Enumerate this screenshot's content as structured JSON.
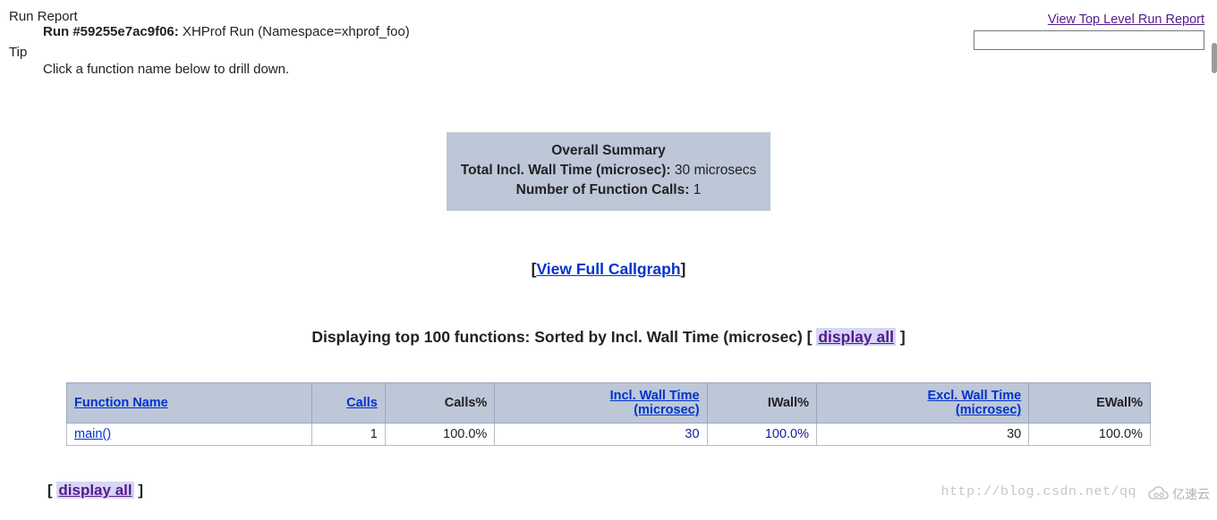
{
  "header": {
    "run_report": "Run Report",
    "run_line_bold": "Run #59255e7ac9f06:",
    "run_line_rest": " XHProf Run (Namespace=xhprof_foo)",
    "tip": "Tip",
    "tip_body": "Click a function name below to drill down."
  },
  "top_right": {
    "link": "View Top Level Run Report",
    "input_value": ""
  },
  "summary": {
    "title": "Overall Summary",
    "row1_label": "Total Incl. Wall Time (microsec):",
    "row1_value": " 30 microsecs",
    "row2_label": "Number of Function Calls:",
    "row2_value": " 1"
  },
  "callgraph": {
    "bracket_open": "[",
    "link": "View Full Callgraph",
    "bracket_close": "]"
  },
  "display_head": {
    "text": "Displaying top 100 functions: Sorted by Incl. Wall Time (microsec) ",
    "bracket_open": "[ ",
    "link": "display all",
    "bracket_close": " ]"
  },
  "table": {
    "cols": {
      "func": "Function Name",
      "calls": "Calls",
      "calls_pct": "Calls%",
      "iwt_line1": "Incl. Wall Time",
      "iwt_line2": "(microsec)",
      "iwall_pct": "IWall%",
      "ewt_line1": "Excl. Wall Time",
      "ewt_line2": "(microsec)",
      "ewall_pct": "EWall%"
    },
    "row": {
      "func": "main()",
      "calls": "1",
      "calls_pct": "100.0%",
      "iwt": "30",
      "iwall_pct": "100.0%",
      "ewt": "30",
      "ewall_pct": "100.0%"
    }
  },
  "bottom": {
    "bracket_open": "[ ",
    "link": "display all",
    "bracket_close": " ]"
  },
  "watermark": "http://blog.csdn.net/qq",
  "logo_text": "亿速云"
}
